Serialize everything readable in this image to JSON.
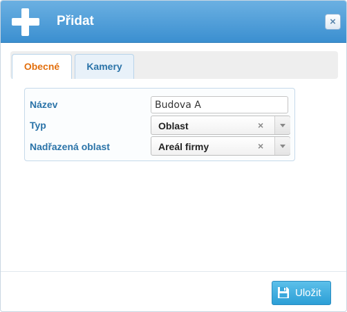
{
  "dialog": {
    "title": "Přidat",
    "title_icon": "plus-icon",
    "close_icon": "close-icon",
    "close_glyph": "×"
  },
  "tabs": [
    {
      "label": "Obecné",
      "active": true
    },
    {
      "label": "Kamery",
      "active": false
    }
  ],
  "form": {
    "name": {
      "label": "Název",
      "value": "Budova A"
    },
    "type": {
      "label": "Typ",
      "value": "Oblast",
      "clear_glyph": "×"
    },
    "parent": {
      "label": "Nadřazená oblast",
      "value": "Areál firmy",
      "clear_glyph": "×"
    }
  },
  "footer": {
    "save_label": "Uložit",
    "save_icon": "floppy-disk-icon"
  },
  "colors": {
    "titlebar": "#3b8fd0",
    "active_tab_text": "#e26f0e",
    "label_text": "#2a73a8",
    "save_button": "#2c9fd6"
  }
}
